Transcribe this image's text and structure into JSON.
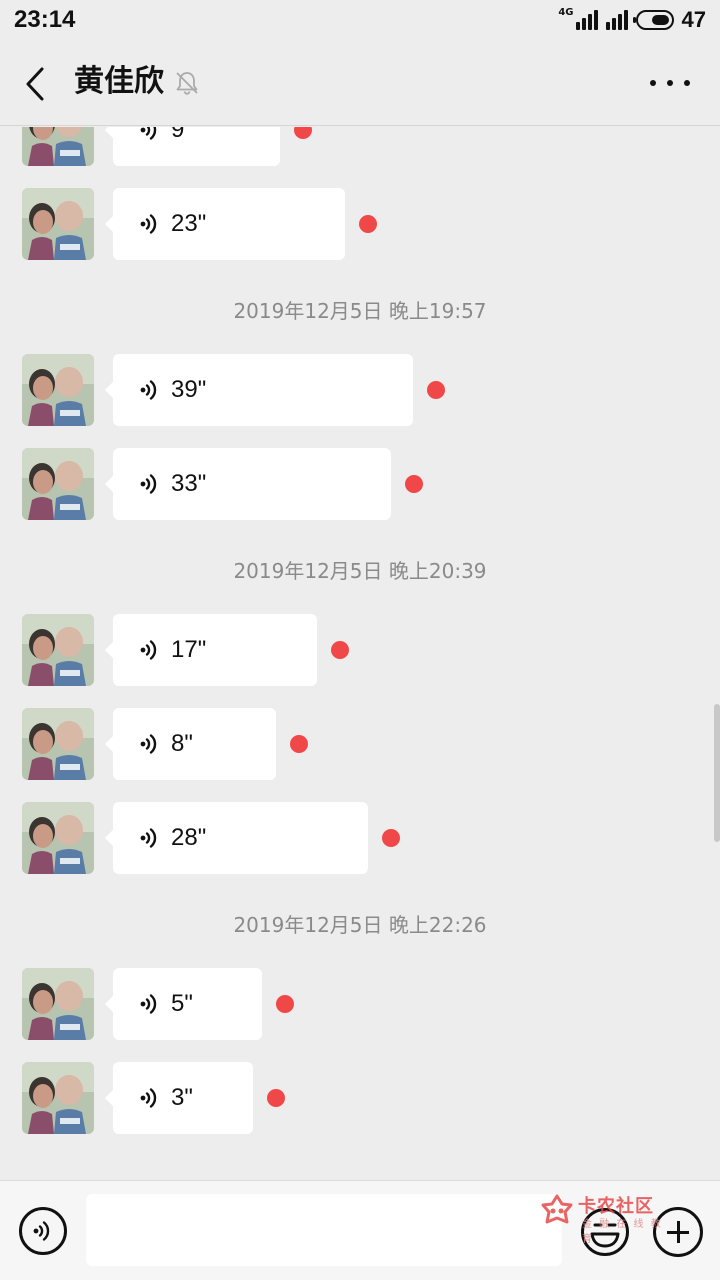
{
  "status_bar": {
    "time": "23:14",
    "network": "4G",
    "battery": "47"
  },
  "header": {
    "title": "黄佳欣",
    "back_icon": "chevron-left-icon",
    "mute_icon": "bell-off-icon",
    "more_icon": "more-dots-icon"
  },
  "messages": [
    {
      "type": "voice",
      "duration": "9\"",
      "unread": true
    },
    {
      "type": "voice",
      "duration": "23\"",
      "unread": true
    },
    {
      "type": "time",
      "text": "2019年12月5日 晚上19:57"
    },
    {
      "type": "voice",
      "duration": "39\"",
      "unread": true
    },
    {
      "type": "voice",
      "duration": "33\"",
      "unread": true
    },
    {
      "type": "time",
      "text": "2019年12月5日 晚上20:39"
    },
    {
      "type": "voice",
      "duration": "17\"",
      "unread": true
    },
    {
      "type": "voice",
      "duration": "8\"",
      "unread": true
    },
    {
      "type": "voice",
      "duration": "28\"",
      "unread": true
    },
    {
      "type": "time",
      "text": "2019年12月5日 晚上22:26"
    },
    {
      "type": "voice",
      "duration": "5\"",
      "unread": true
    },
    {
      "type": "voice",
      "duration": "3\"",
      "unread": true
    }
  ],
  "input_bar": {
    "voice_icon": "voice-mode-icon",
    "text_value": "",
    "emoji_icon": "emoji-icon",
    "plus_icon": "plus-circle-icon"
  },
  "watermark": {
    "title": "卡农社区",
    "subtitle": "金 融 在 线 教 育"
  },
  "colors": {
    "background": "#ededed",
    "bubble": "#ffffff",
    "unread_dot": "#f04848",
    "timestamp": "#8a8a8a"
  }
}
